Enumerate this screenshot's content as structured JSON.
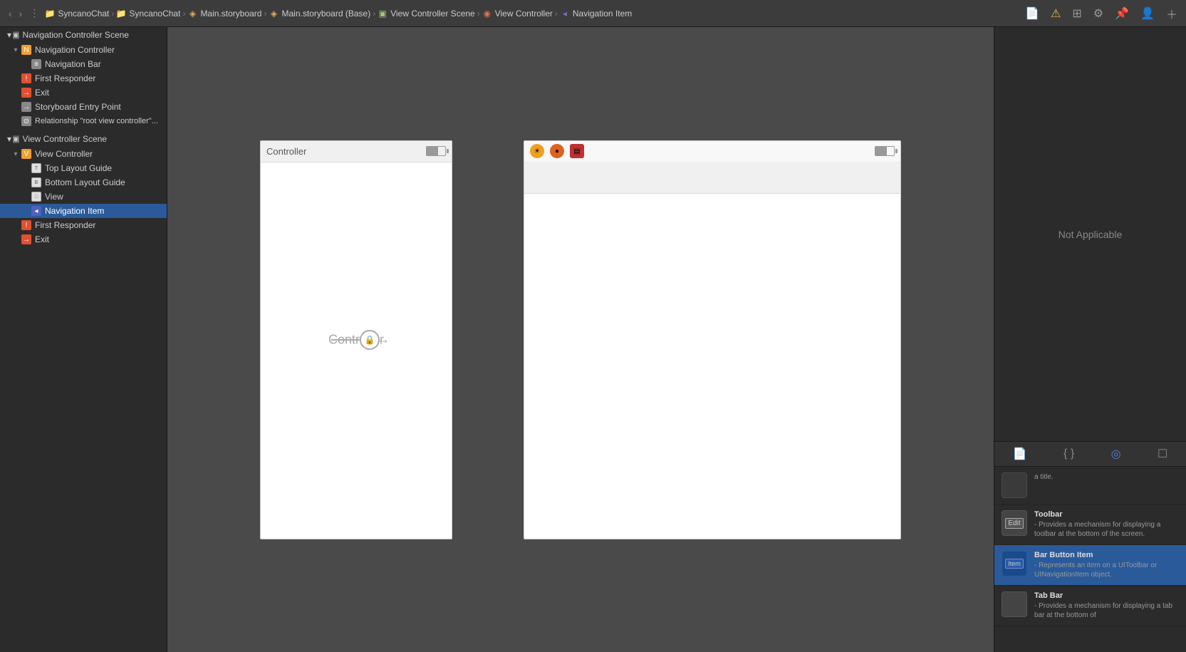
{
  "topbar": {
    "nav_back": "‹",
    "nav_forward": "›",
    "breadcrumbs": [
      {
        "label": "SyncanoChat",
        "type": "folder"
      },
      {
        "label": "SyncanoChat",
        "type": "folder"
      },
      {
        "label": "Main.storyboard",
        "type": "storyboard"
      },
      {
        "label": "Main.storyboard (Base)",
        "type": "storyboard"
      },
      {
        "label": "View Controller Scene",
        "type": "scene"
      },
      {
        "label": "View Controller",
        "type": "vc"
      },
      {
        "label": "Navigation Item",
        "type": "navitem"
      }
    ],
    "right_buttons": [
      "doc",
      "warn",
      "grid",
      "gear",
      "pin",
      "person",
      "plus"
    ]
  },
  "navigator": {
    "sections": [
      {
        "id": "nav-controller-scene",
        "label": "Navigation Controller Scene",
        "expanded": true,
        "indent": 0,
        "icon_type": "scene",
        "children": [
          {
            "id": "nav-controller",
            "label": "Navigation Controller",
            "expanded": true,
            "indent": 1,
            "icon_type": "nav-ctrl",
            "children": [
              {
                "id": "nav-bar",
                "label": "Navigation Bar",
                "indent": 2,
                "icon_type": "nav-bar"
              }
            ]
          },
          {
            "id": "first-responder-1",
            "label": "First Responder",
            "indent": 1,
            "icon_type": "responder"
          },
          {
            "id": "exit-1",
            "label": "Exit",
            "indent": 1,
            "icon_type": "exit"
          },
          {
            "id": "storyboard-entry",
            "label": "Storyboard Entry Point",
            "indent": 1,
            "icon_type": "storyboard"
          },
          {
            "id": "relationship",
            "label": "Relationship \"root view controller\"...",
            "indent": 1,
            "icon_type": "relationship"
          }
        ]
      },
      {
        "id": "vc-scene",
        "label": "View Controller Scene",
        "expanded": true,
        "indent": 0,
        "icon_type": "scene",
        "children": [
          {
            "id": "view-controller",
            "label": "View Controller",
            "expanded": true,
            "indent": 1,
            "icon_type": "view-ctrl",
            "children": [
              {
                "id": "top-layout",
                "label": "Top Layout Guide",
                "indent": 2,
                "icon_type": "layout"
              },
              {
                "id": "bottom-layout",
                "label": "Bottom Layout Guide",
                "indent": 2,
                "icon_type": "layout"
              },
              {
                "id": "view",
                "label": "View",
                "indent": 2,
                "icon_type": "view"
              },
              {
                "id": "nav-item",
                "label": "Navigation Item",
                "indent": 2,
                "icon_type": "nav-item",
                "selected": true
              }
            ]
          },
          {
            "id": "first-responder-2",
            "label": "First Responder",
            "indent": 1,
            "icon_type": "responder"
          },
          {
            "id": "exit-2",
            "label": "Exit",
            "indent": 1,
            "icon_type": "exit"
          }
        ]
      }
    ]
  },
  "canvas": {
    "controller_panel": {
      "label": "Controller"
    },
    "vc_panel": {
      "icons": [
        "☀",
        "●",
        "▤"
      ]
    },
    "segue": {
      "lock_symbol": "🔒"
    }
  },
  "right_panel": {
    "not_applicable": "Not Applicable",
    "toolbar_buttons": [
      "doc",
      "brackets",
      "circle",
      "square"
    ],
    "library_items": [
      {
        "id": "toolbar",
        "icon_label": "Edit",
        "title": "Toolbar",
        "description": "- Provides a mechanism for displaying a toolbar at the bottom of the screen."
      },
      {
        "id": "bar-button-item",
        "icon_label": "Item",
        "title": "Bar Button Item",
        "description": "- Represents an item on a UIToolbar or UINavigationItem object.",
        "selected": true
      },
      {
        "id": "tab-bar",
        "icon_label": "",
        "title": "Tab Bar",
        "description": "- Provides a mechanism for displaying a tab bar at the bottom of"
      }
    ]
  }
}
